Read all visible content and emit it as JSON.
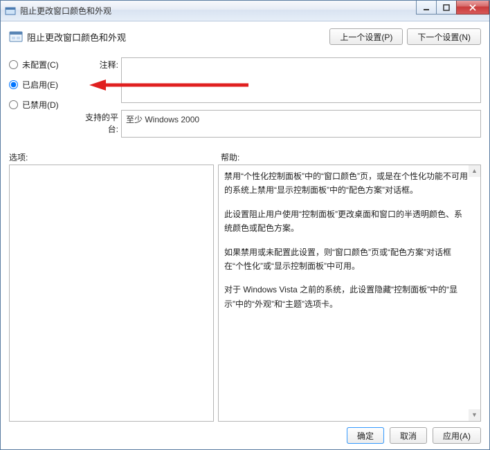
{
  "title": "阻止更改窗口颜色和外观",
  "header": {
    "policy_title": "阻止更改窗口颜色和外观",
    "prev_btn": "上一个设置(P)",
    "next_btn": "下一个设置(N)"
  },
  "radios": {
    "not_configured": "未配置(C)",
    "enabled": "已启用(E)",
    "disabled": "已禁用(D)"
  },
  "fields": {
    "comment_label": "注释:",
    "comment_value": "",
    "platform_label": "支持的平台:",
    "platform_value": "至少 Windows 2000"
  },
  "panels": {
    "options_label": "选项:",
    "help_label": "帮助:",
    "help_paras": [
      "禁用“个性化控制面板”中的“窗口颜色”页，或是在个性化功能不可用的系统上禁用“显示控制面板”中的“配色方案”对话框。",
      "此设置阻止用户使用“控制面板”更改桌面和窗口的半透明颜色、系统颜色或配色方案。",
      "如果禁用或未配置此设置，则“窗口颜色”页或“配色方案”对话框在“个性化”或“显示控制面板”中可用。",
      "对于 Windows Vista 之前的系统，此设置隐藏“控制面板”中的“显示”中的“外观”和“主题”选项卡。"
    ]
  },
  "buttons": {
    "ok": "确定",
    "cancel": "取消",
    "apply": "应用(A)"
  }
}
